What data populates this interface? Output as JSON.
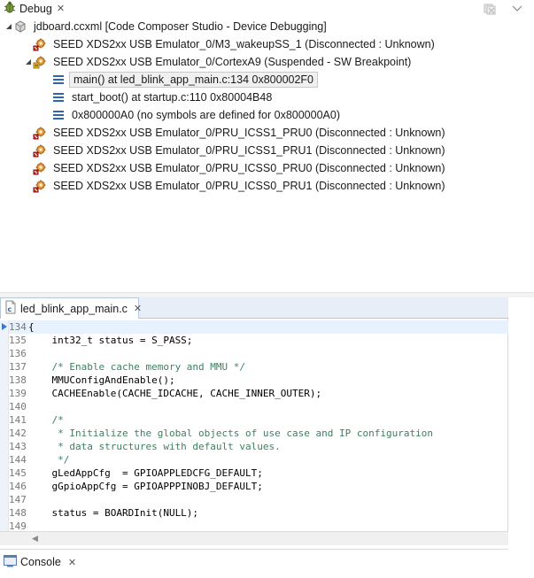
{
  "debug_view": {
    "title": "Debug",
    "close_glyph": "✕",
    "toolbar": {
      "remove_icon": "remove-all-terminated-icon",
      "menu_icon": "view-menu-icon"
    },
    "tree": [
      {
        "label": "jdboard.ccxml [Code Composer Studio - Device Debugging]",
        "indent": 0,
        "twisty": "expanded",
        "icon": "config-file-icon",
        "selected": false
      },
      {
        "label": "SEED XDS2xx USB Emulator_0/M3_wakeupSS_1 (Disconnected : Unknown)",
        "indent": 1,
        "twisty": "none",
        "icon": "disconnected-core-icon",
        "selected": false
      },
      {
        "label": "SEED XDS2xx USB Emulator_0/CortexA9 (Suspended - SW Breakpoint)",
        "indent": 1,
        "twisty": "expanded",
        "icon": "suspended-core-icon",
        "selected": false
      },
      {
        "label": "main() at led_blink_app_main.c:134 0x800002F0",
        "indent": 2,
        "twisty": "none",
        "icon": "stack-frame-icon",
        "selected": true
      },
      {
        "label": "start_boot() at startup.c:110 0x80004B48",
        "indent": 2,
        "twisty": "none",
        "icon": "stack-frame-icon",
        "selected": false
      },
      {
        "label": "0x800000A0  (no symbols are defined for 0x800000A0)",
        "indent": 2,
        "twisty": "none",
        "icon": "stack-frame-icon",
        "selected": false
      },
      {
        "label": "SEED XDS2xx USB Emulator_0/PRU_ICSS1_PRU0 (Disconnected : Unknown)",
        "indent": 1,
        "twisty": "none",
        "icon": "disconnected-core-icon",
        "selected": false
      },
      {
        "label": "SEED XDS2xx USB Emulator_0/PRU_ICSS1_PRU1 (Disconnected : Unknown)",
        "indent": 1,
        "twisty": "none",
        "icon": "disconnected-core-icon",
        "selected": false
      },
      {
        "label": "SEED XDS2xx USB Emulator_0/PRU_ICSS0_PRU0 (Disconnected : Unknown)",
        "indent": 1,
        "twisty": "none",
        "icon": "disconnected-core-icon",
        "selected": false
      },
      {
        "label": "SEED XDS2xx USB Emulator_0/PRU_ICSS0_PRU1 (Disconnected : Unknown)",
        "indent": 1,
        "twisty": "none",
        "icon": "disconnected-core-icon",
        "selected": false
      }
    ]
  },
  "editor": {
    "tab_label": "led_blink_app_main.c",
    "close_glyph": "✕",
    "current_line": "134",
    "lines": [
      {
        "num": "134",
        "text": "{",
        "kind": "code"
      },
      {
        "num": "135",
        "text": "    int32_t status = S_PASS;",
        "kind": "code"
      },
      {
        "num": "136",
        "text": "",
        "kind": "code"
      },
      {
        "num": "137",
        "text": "    /* Enable cache memory and MMU */",
        "kind": "comment"
      },
      {
        "num": "138",
        "text": "    MMUConfigAndEnable();",
        "kind": "code"
      },
      {
        "num": "139",
        "text": "    CACHEEnable(CACHE_IDCACHE, CACHE_INNER_OUTER);",
        "kind": "code"
      },
      {
        "num": "140",
        "text": "",
        "kind": "code"
      },
      {
        "num": "141",
        "text": "    /*",
        "kind": "comment"
      },
      {
        "num": "142",
        "text": "     * Initialize the global objects of use case and IP configuration",
        "kind": "comment"
      },
      {
        "num": "143",
        "text": "     * data structures with default values.",
        "kind": "comment"
      },
      {
        "num": "144",
        "text": "     */",
        "kind": "comment"
      },
      {
        "num": "145",
        "text": "    gLedAppCfg  = GPIOAPPLEDCFG_DEFAULT;",
        "kind": "code"
      },
      {
        "num": "146",
        "text": "    gGpioAppCfg = GPIOAPPPINOBJ_DEFAULT;",
        "kind": "code"
      },
      {
        "num": "147",
        "text": "",
        "kind": "code"
      },
      {
        "num": "148",
        "text": "    status = BOARDInit(NULL);",
        "kind": "code"
      },
      {
        "num": "149",
        "text": "",
        "kind": "code"
      }
    ]
  },
  "console": {
    "title": "Console",
    "close_glyph": "✕"
  },
  "colors": {
    "comment": "#3f7f5f",
    "line_number": "#787878",
    "current_line_bg": "#e8f2fe",
    "tab_border": "#b9c7dd"
  }
}
